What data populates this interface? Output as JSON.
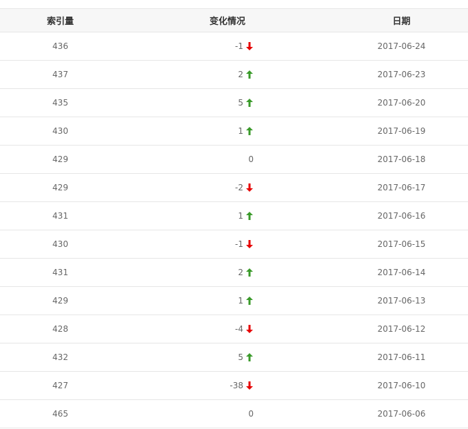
{
  "table": {
    "headers": {
      "index": "索引量",
      "change": "变化情况",
      "date": "日期"
    },
    "rows": [
      {
        "index": "436",
        "change": "-1",
        "direction": "down",
        "date": "2017-06-24"
      },
      {
        "index": "437",
        "change": "2",
        "direction": "up",
        "date": "2017-06-23"
      },
      {
        "index": "435",
        "change": "5",
        "direction": "up",
        "date": "2017-06-20"
      },
      {
        "index": "430",
        "change": "1",
        "direction": "up",
        "date": "2017-06-19"
      },
      {
        "index": "429",
        "change": "0",
        "direction": "none",
        "date": "2017-06-18"
      },
      {
        "index": "429",
        "change": "-2",
        "direction": "down",
        "date": "2017-06-17"
      },
      {
        "index": "431",
        "change": "1",
        "direction": "up",
        "date": "2017-06-16"
      },
      {
        "index": "430",
        "change": "-1",
        "direction": "down",
        "date": "2017-06-15"
      },
      {
        "index": "431",
        "change": "2",
        "direction": "up",
        "date": "2017-06-14"
      },
      {
        "index": "429",
        "change": "1",
        "direction": "up",
        "date": "2017-06-13"
      },
      {
        "index": "428",
        "change": "-4",
        "direction": "down",
        "date": "2017-06-12"
      },
      {
        "index": "432",
        "change": "5",
        "direction": "up",
        "date": "2017-06-11"
      },
      {
        "index": "427",
        "change": "-38",
        "direction": "down",
        "date": "2017-06-10"
      },
      {
        "index": "465",
        "change": "0",
        "direction": "none",
        "date": "2017-06-06"
      }
    ]
  },
  "colors": {
    "up": "#3a9a2a",
    "down": "#e60000"
  },
  "icons": {
    "up": "arrow-up-icon",
    "down": "arrow-down-icon"
  }
}
